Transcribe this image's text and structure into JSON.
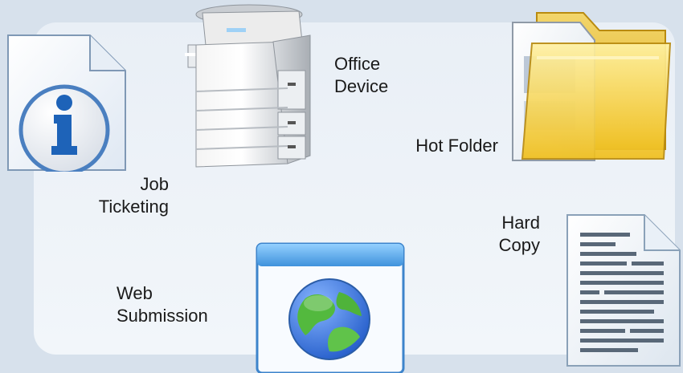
{
  "labels": {
    "job_ticketing": [
      "Job",
      "Ticketing"
    ],
    "office_device": [
      "Office",
      "Device"
    ],
    "hot_folder": [
      "Hot Folder"
    ],
    "web_submission": [
      "Web",
      "Submission"
    ],
    "hard_copy": [
      "Hard",
      "Copy"
    ]
  },
  "icons": {
    "job_ticketing": "info-document-icon",
    "office_device": "printer-copier-icon",
    "hot_folder": "folder-icon",
    "web_submission": "globe-browser-window-icon",
    "hard_copy": "paper-document-icon"
  },
  "colors": {
    "background": "#d7e1ec",
    "panel": "#eef3f8",
    "info_blue": "#1e63b8",
    "folder_yellow": "#f6cf3a",
    "window_blue": "#4ea4e8",
    "globe_green": "#4fb33a"
  }
}
